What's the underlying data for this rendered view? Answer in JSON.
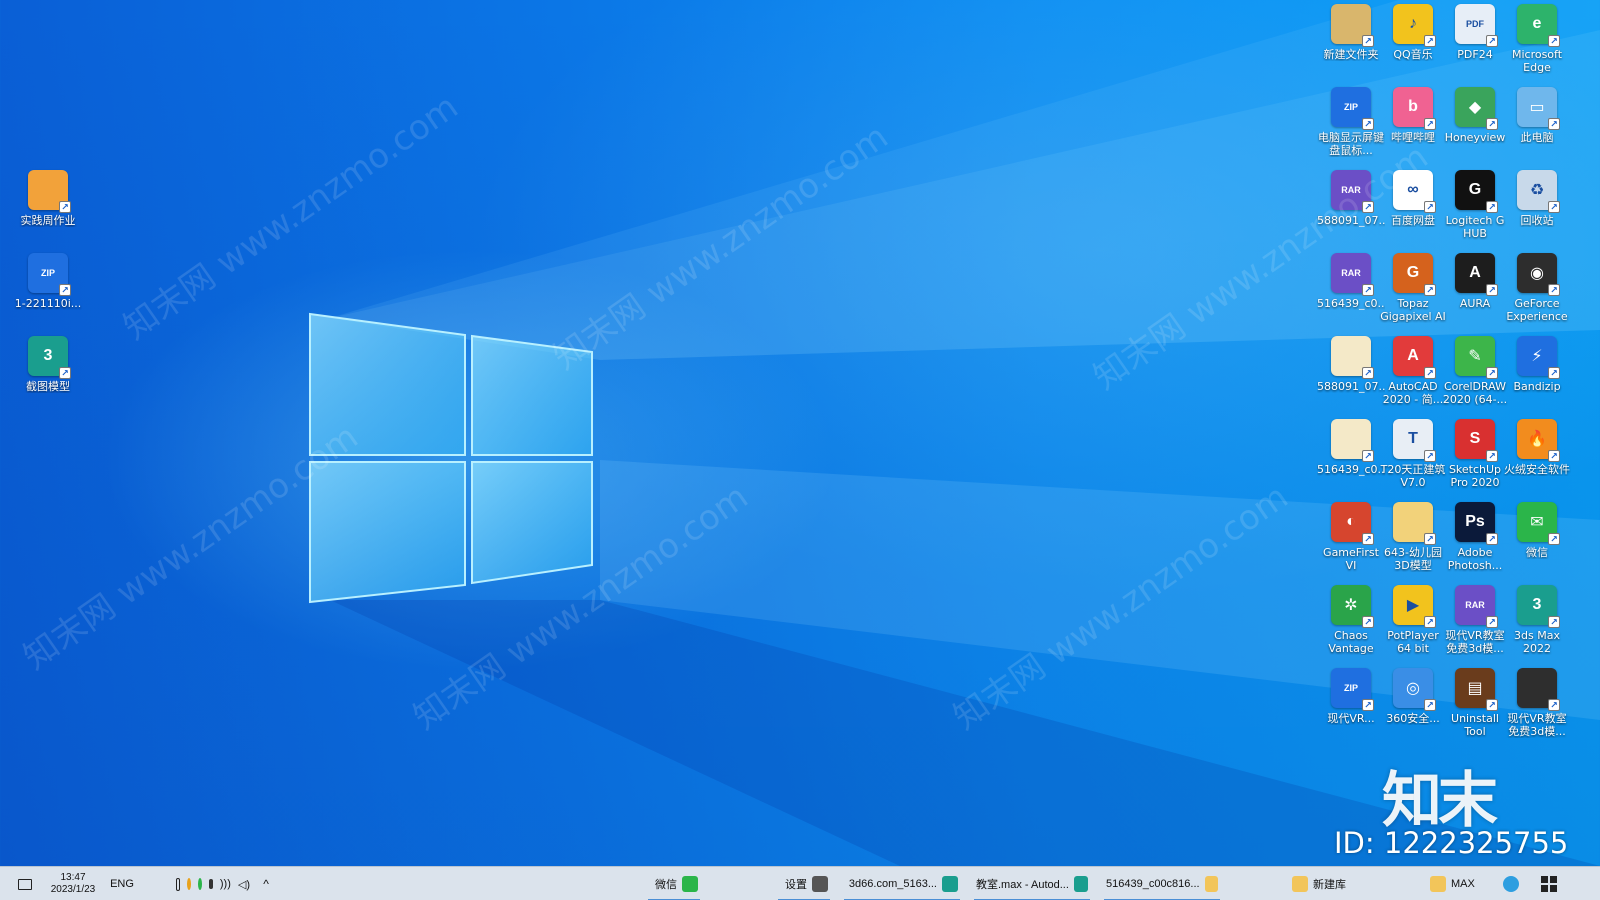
{
  "desktop": {
    "left_icons": [
      {
        "label": "实践周作业",
        "icon": "document-icon",
        "color": "#f2a23a",
        "glyph": ""
      },
      {
        "label": "1-221110i...",
        "icon": "bandizip-zip-icon",
        "color": "#1f6fe0",
        "glyph": "ZIP"
      },
      {
        "label": "截图模型",
        "icon": "3dsmax-icon",
        "color": "#1a9e8e",
        "glyph": "3"
      }
    ],
    "right_icons": [
      {
        "label": "Microsoft Edge",
        "icon": "edge-icon",
        "color": "#2db36b",
        "glyph": "e"
      },
      {
        "label": "PDF24",
        "icon": "pdf24-icon",
        "color": "#e7eef7",
        "glyph": "PDF"
      },
      {
        "label": "QQ音乐",
        "icon": "qq-music-icon",
        "color": "#f2c31d",
        "glyph": "♪"
      },
      {
        "label": "新建文件夹",
        "icon": "folder-icon",
        "color": "#d9b66c",
        "glyph": ""
      },
      {
        "label": "此电脑",
        "icon": "computer-icon",
        "color": "#6fb7ec",
        "glyph": "▭"
      },
      {
        "label": "Honeyview",
        "icon": "honeyview-icon",
        "color": "#3aa45c",
        "glyph": "◆"
      },
      {
        "label": "哔哩哔哩",
        "icon": "bilibili-icon",
        "color": "#f06292",
        "glyph": "b"
      },
      {
        "label": "电脑显示屏键盘鼠标...",
        "icon": "bandizip-zip-icon",
        "color": "#1f6fe0",
        "glyph": "ZIP"
      },
      {
        "label": "回收站",
        "icon": "recycle-bin-icon",
        "color": "#c8d9ea",
        "glyph": "♻"
      },
      {
        "label": "Logitech G HUB",
        "icon": "logitech-icon",
        "color": "#111111",
        "glyph": "G"
      },
      {
        "label": "百度网盘",
        "icon": "baidu-netdisk-icon",
        "color": "#ffffff",
        "glyph": "∞"
      },
      {
        "label": "588091_07...",
        "icon": "bandizip-rar-icon",
        "color": "#6b4fc6",
        "glyph": "RAR"
      },
      {
        "label": "GeForce Experience",
        "icon": "nvidia-icon",
        "color": "#2d2d2d",
        "glyph": "◉"
      },
      {
        "label": "AURA",
        "icon": "aura-icon",
        "color": "#1d1d1d",
        "glyph": "A"
      },
      {
        "label": "Topaz Gigapixel AI",
        "icon": "topaz-icon",
        "color": "#d5621d",
        "glyph": "G"
      },
      {
        "label": "516439_c0...",
        "icon": "bandizip-rar-icon",
        "color": "#6b4fc6",
        "glyph": "RAR"
      },
      {
        "label": "Bandizip",
        "icon": "bandizip-icon",
        "color": "#1f6fe0",
        "glyph": "⚡"
      },
      {
        "label": "CorelDRAW 2020 (64-...",
        "icon": "coreldraw-icon",
        "color": "#3db54a",
        "glyph": "✎"
      },
      {
        "label": "AutoCAD 2020 - 简...",
        "icon": "autocad-icon",
        "color": "#e23b3b",
        "glyph": "A"
      },
      {
        "label": "588091_07...",
        "icon": "file-icon",
        "color": "#f4e9c8",
        "glyph": ""
      },
      {
        "label": "火绒安全软件",
        "icon": "huorong-icon",
        "color": "#f28c1e",
        "glyph": "🔥"
      },
      {
        "label": "SketchUp Pro 2020",
        "icon": "sketchup-icon",
        "color": "#d93030",
        "glyph": "S"
      },
      {
        "label": "T20天正建筑 V7.0",
        "icon": "tangent-icon",
        "color": "#e8eef5",
        "glyph": "T"
      },
      {
        "label": "516439_c0...",
        "icon": "file-icon",
        "color": "#f4e9c8",
        "glyph": ""
      },
      {
        "label": "微信",
        "icon": "wechat-icon",
        "color": "#2bb54a",
        "glyph": "✉"
      },
      {
        "label": "Adobe Photosh...",
        "icon": "photoshop-icon",
        "color": "#0b1a3a",
        "glyph": "Ps"
      },
      {
        "label": "643-幼儿园3D模型",
        "icon": "folder-icon",
        "color": "#f2d27a",
        "glyph": ""
      },
      {
        "label": "GameFirst VI",
        "icon": "gamefirst-icon",
        "color": "#d6452e",
        "glyph": "◐"
      },
      {
        "label": "3ds Max 2022",
        "icon": "3dsmax-icon",
        "color": "#1a9e8e",
        "glyph": "3"
      },
      {
        "label": "现代VR教室免费3d模...",
        "icon": "bandizip-rar-icon",
        "color": "#6b4fc6",
        "glyph": "RAR"
      },
      {
        "label": "PotPlayer 64 bit",
        "icon": "potplayer-icon",
        "color": "#f2c31d",
        "glyph": "▶"
      },
      {
        "label": "Chaos Vantage",
        "icon": "chaos-vantage-icon",
        "color": "#2aa44a",
        "glyph": "✲"
      },
      {
        "label": "现代VR教室免费3d模...",
        "icon": "file-icon",
        "color": "#2e2e2e",
        "glyph": ""
      },
      {
        "label": "Uninstall Tool",
        "icon": "uninstall-tool-icon",
        "color": "#6a3c1c",
        "glyph": "▤"
      },
      {
        "label": "360安全...",
        "icon": "360-icon",
        "color": "#3a8ee6",
        "glyph": "◎"
      },
      {
        "label": "现代VR...",
        "icon": "bandizip-zip-icon",
        "color": "#1f6fe0",
        "glyph": "ZIP"
      }
    ],
    "watermark_text": "知末网 www.znzmo.com",
    "brand_text": "知末",
    "id_text": "ID: 1222325755"
  },
  "taskbar": {
    "start": {
      "icon": "windows-start-icon"
    },
    "edge": {
      "icon": "edge-icon"
    },
    "pinned_max": {
      "label": "MAX",
      "icon": "folder-icon"
    },
    "pinned_new": {
      "label": "新建库",
      "icon": "folder-icon"
    },
    "items": [
      {
        "label": "516439_c00c816...",
        "icon": "folder-icon",
        "color": "#f2c55a"
      },
      {
        "label": "教室.max - Autod...",
        "icon": "3dsmax-icon",
        "color": "#1a9e8e"
      },
      {
        "label": "3d66.com_5163...",
        "icon": "3dsmax-icon",
        "color": "#1a9e8e"
      },
      {
        "label": "设置",
        "icon": "gear-icon",
        "color": "#555555"
      },
      {
        "label": "微信",
        "icon": "wechat-icon",
        "color": "#2bb54a"
      }
    ],
    "tray": {
      "lang": "ENG",
      "time": "13:47",
      "date": "2023/1/23"
    }
  }
}
